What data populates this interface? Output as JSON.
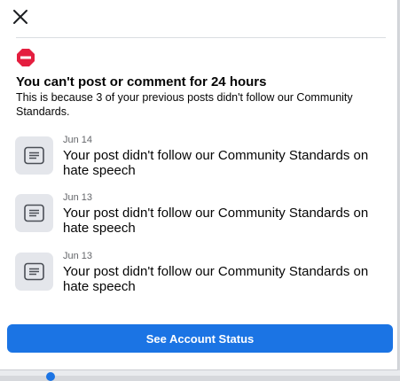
{
  "dialog": {
    "close_icon": "close-icon",
    "warning_icon": "stop-icon",
    "title": "You can't post or comment for 24 hours",
    "subtitle": "This is because 3 of your previous posts didn't follow our Community Standards.",
    "violations": [
      {
        "date": "Jun 14",
        "text": "Your post didn't follow our Community Standards on hate speech",
        "icon": "post-icon"
      },
      {
        "date": "Jun 13",
        "text": "Your post didn't follow our Community Standards on hate speech",
        "icon": "post-icon"
      },
      {
        "date": "Jun 13",
        "text": "Your post didn't follow our Community Standards on hate speech",
        "icon": "post-icon"
      }
    ],
    "primary_button": "See Account Status"
  },
  "colors": {
    "accent": "#1b74e4",
    "danger": "#e41e3f",
    "icon_bg": "#e4e6eb",
    "secondary_text": "#65676b"
  }
}
